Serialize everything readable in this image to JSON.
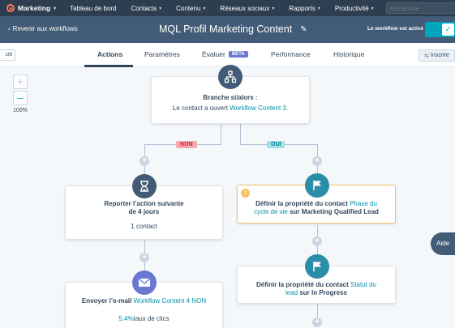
{
  "nav": {
    "brand": "Marketing",
    "items": [
      "Tableau de bord",
      "Contacts",
      "Contenu",
      "Réseaux sociaux",
      "Rapports",
      "Productivité"
    ],
    "search_placeholder": "Recherche"
  },
  "header": {
    "back_label": "Revenir aux workflows",
    "title": "MQL Profil Marketing Content",
    "status_label": "Le workflow est activé",
    "toggle_on": true
  },
  "tabs": {
    "left_stub": "ctif",
    "items": [
      {
        "label": "Actions",
        "active": true
      },
      {
        "label": "Paramètres"
      },
      {
        "label": "Évaluer",
        "badge": "BÊTA"
      },
      {
        "label": "Performance"
      },
      {
        "label": "Historique"
      }
    ],
    "enroll_label": "Inscrire"
  },
  "canvas": {
    "zoom_label": "100%",
    "branch": {
      "title": "Branche si/alors :",
      "text_prefix": "Le contact a ouvert ",
      "link": "Workflow Content 3",
      "text_suffix": "."
    },
    "branch_no": "NON",
    "branch_yes": "OUI",
    "delay": {
      "title": "Reporter l’action suivante de 4 jours",
      "count": "1 contact"
    },
    "email": {
      "title_prefix": "Envoyer l’e-mail ",
      "link": "Workflow Content 4 NON",
      "stat_value": "5,4%",
      "stat_label": "taux de clics"
    },
    "set_lifecycle": {
      "prefix": "Définir la propriété du contact ",
      "link": "Phase du cycle de vie",
      "suffix": " sur Marketing Qualified Lead",
      "warning": "!"
    },
    "set_status": {
      "prefix": "Définir la propriété du contact ",
      "link": "Statut du lead",
      "suffix": " sur In Progress"
    }
  },
  "help_label": "Aide",
  "colors": {
    "nav_bg": "#2d3e50",
    "header_bg": "#425b76",
    "accent": "#00a4bd",
    "link": "#0091ae",
    "warning": "#f5c26b"
  }
}
